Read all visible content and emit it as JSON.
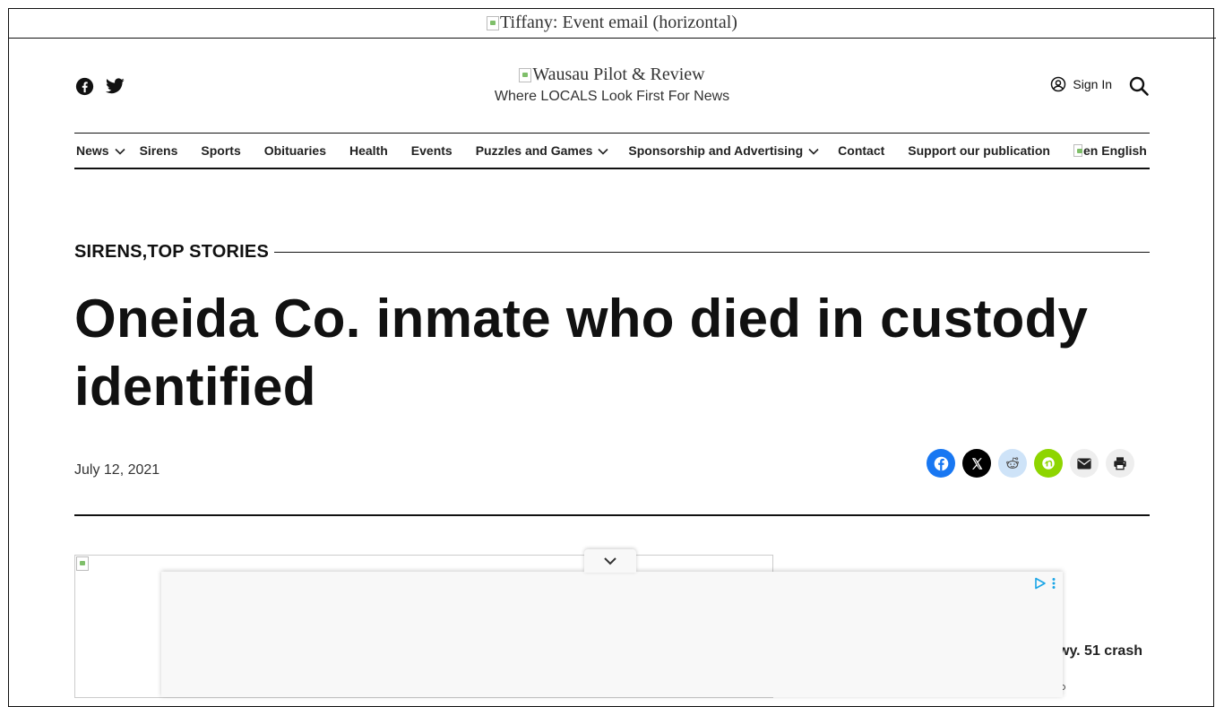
{
  "top_banner": {
    "alt": "Tiffany: Event email (horizontal)"
  },
  "header": {
    "logo_alt": "Wausau Pilot & Review",
    "tagline": "Where LOCALS Look First For News",
    "sign_in": "Sign In",
    "social_icons": [
      "facebook-icon",
      "twitter-icon"
    ]
  },
  "nav": {
    "items": [
      {
        "label": "News",
        "dropdown": true
      },
      {
        "label": "Sirens",
        "dropdown": false
      },
      {
        "label": "Sports",
        "dropdown": false
      },
      {
        "label": "Obituaries",
        "dropdown": false
      },
      {
        "label": "Health",
        "dropdown": false
      },
      {
        "label": "Events",
        "dropdown": false
      },
      {
        "label": "Puzzles and Games",
        "dropdown": true
      },
      {
        "label": "Sponsorship and Advertising",
        "dropdown": true
      },
      {
        "label": "Contact",
        "dropdown": false
      },
      {
        "label": "Support our publication",
        "dropdown": false
      }
    ],
    "language_flag_alt": "en",
    "language_label": "English"
  },
  "article": {
    "category": "SIRENS,TOP STORIES",
    "headline": "Oneida Co. inmate who died in custody identified",
    "date": "July 12, 2021"
  },
  "share_buttons": [
    {
      "icon": "facebook-icon",
      "color": "#1877f2"
    },
    {
      "icon": "x-icon",
      "color": "#000000"
    },
    {
      "icon": "reddit-icon",
      "color": "#cee3f8"
    },
    {
      "icon": "nextdoor-icon",
      "color": "#8ed500"
    },
    {
      "icon": "email-icon",
      "color": "#eeeeee"
    },
    {
      "icon": "print-icon",
      "color": "#eeeeee"
    }
  ],
  "sidebar": {
    "partial_headline": "wy. 51 crash"
  },
  "ad": {
    "choices_icon": "adchoices-icon"
  }
}
